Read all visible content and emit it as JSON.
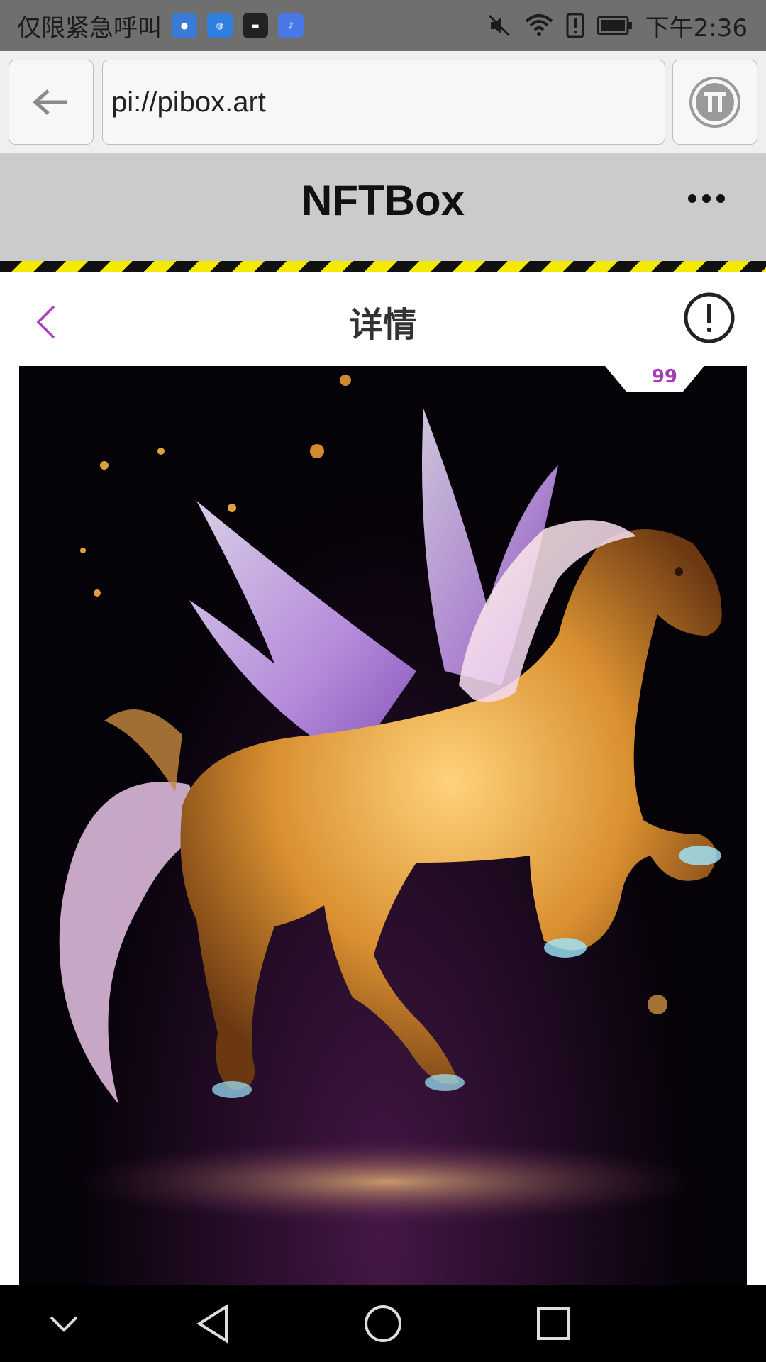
{
  "status_bar": {
    "carrier_text": "仅限紧急呼叫",
    "time": "下午2:36",
    "notification_icons": [
      "app-icon-1",
      "globe-icon",
      "huawei-icon",
      "music-icon"
    ],
    "system_icons": [
      "mute-icon",
      "wifi-icon",
      "alert-icon",
      "battery-icon"
    ]
  },
  "browser": {
    "url": "pi://pibox.art",
    "back_icon": "arrow-left-icon",
    "pi_icon": "pi-logo-icon"
  },
  "app_bar": {
    "title": "NFTBox",
    "menu_icon": "more-dots-icon"
  },
  "page": {
    "title": "详情",
    "back_icon": "chevron-left-icon",
    "info_icon": "exclamation-circle-icon",
    "accent_color": "#b03cc6"
  },
  "artwork": {
    "badge_text": "99",
    "subject": "golden winged horse"
  },
  "nav_bar": {
    "buttons": [
      "collapse-icon",
      "back-triangle-icon",
      "home-circle-icon",
      "recents-square-icon"
    ]
  }
}
